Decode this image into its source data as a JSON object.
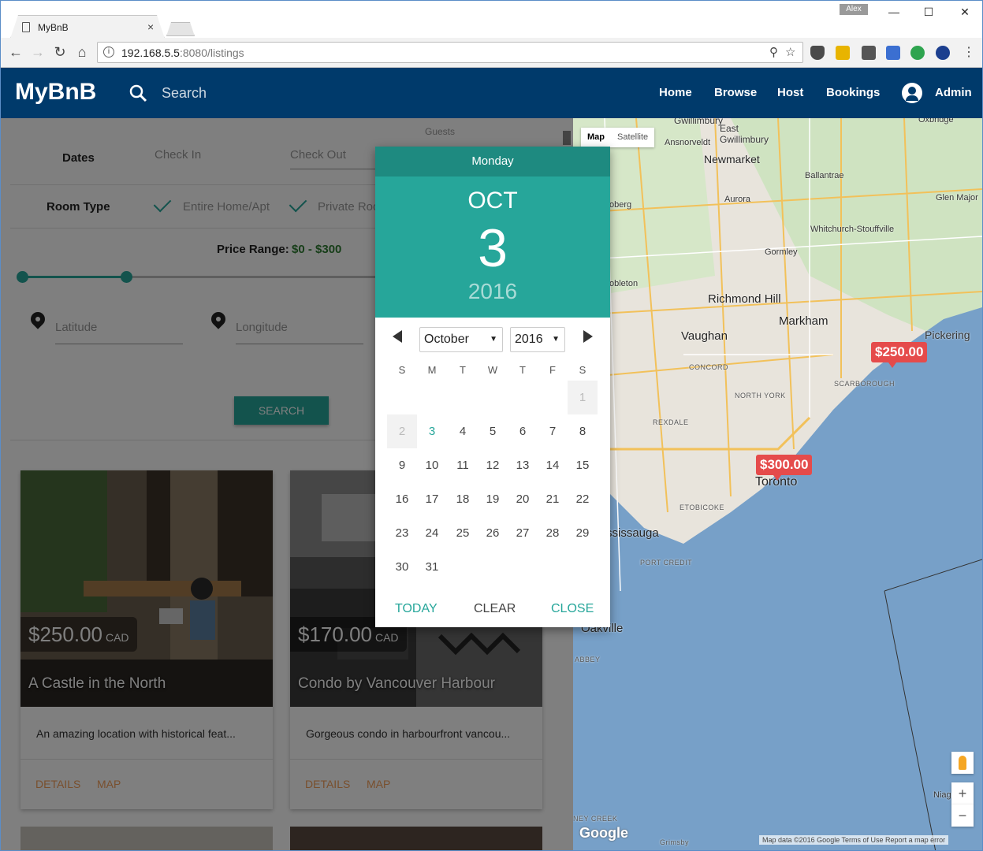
{
  "browser": {
    "tab_title": "MyBnB",
    "tab_close": "×",
    "user_badge": "Alex",
    "minimize": "—",
    "maximize": "☐",
    "close": "✕",
    "url_host": "192.168.5.5",
    "url_rest": ":8080/listings"
  },
  "header": {
    "logo": "MyBnB",
    "search_label": "Search",
    "nav": [
      "Home",
      "Browse",
      "Host",
      "Bookings"
    ],
    "user": "Admin"
  },
  "filters": {
    "guests_label": "Guests",
    "dates_label": "Dates",
    "check_in": "Check In",
    "check_out": "Check Out",
    "room_type_label": "Room Type",
    "room_types": [
      "Entire Home/Apt",
      "Private Roo"
    ],
    "price_label": "Price Range:",
    "price_value": "$0 - $300",
    "price_min_fraction": 0,
    "price_max_fraction": 0.29,
    "latitude": "Latitude",
    "longitude": "Longitude",
    "search_button": "SEARCH"
  },
  "listings": [
    {
      "price": "$250.00",
      "currency": "CAD",
      "title": "A Castle in the North",
      "description": "An amazing location with historical feat...",
      "actions": [
        "DETAILS",
        "MAP"
      ]
    },
    {
      "price": "$170.00",
      "currency": "CAD",
      "title": "Condo by Vancouver Harbour",
      "description": "Gorgeous condo in harbourfront vancou...",
      "actions": [
        "DETAILS",
        "MAP"
      ]
    }
  ],
  "datepicker": {
    "weekday": "Monday",
    "month_short": "OCT",
    "day": "3",
    "year": "2016",
    "month_select": "October",
    "year_select": "2016",
    "weekday_headers": [
      "S",
      "M",
      "T",
      "W",
      "T",
      "F",
      "S"
    ],
    "days": [
      "1",
      "2",
      "3",
      "4",
      "5",
      "6",
      "7",
      "8",
      "9",
      "10",
      "11",
      "12",
      "13",
      "14",
      "15",
      "16",
      "17",
      "18",
      "19",
      "20",
      "21",
      "22",
      "23",
      "24",
      "25",
      "26",
      "27",
      "28",
      "29",
      "30",
      "31"
    ],
    "today_button": "TODAY",
    "clear_button": "CLEAR",
    "close_button": "CLOSE"
  },
  "map": {
    "type_map": "Map",
    "type_satellite": "Satellite",
    "places": [
      "Gwillimbury",
      "East Gwillimbury",
      "Ansnorveldt",
      "Oxbridge",
      "Newmarket",
      "Ballantrae",
      "Aurora",
      "Glen Major",
      "Whitchurch-Stouffville",
      "Gormley",
      "Richmond Hill",
      "Markham",
      "Vaughan",
      "Pickering",
      "Toronto",
      "Oakville",
      "ssissauga",
      "Niagara-o",
      "oberg",
      "obleton"
    ],
    "districts": [
      "CONCORD",
      "NORTH YORK",
      "SCARBOROUGH",
      "REXDALE",
      "ETOBICOKE",
      "PORT CREDIT",
      "ABBEY",
      "NEY CREEK",
      "Grimsby"
    ],
    "price_pins": [
      "$250.00",
      "$300.00"
    ],
    "zoom_in": "+",
    "zoom_out": "−",
    "google": "Google",
    "attribution": "Map data ©2016 Google   Terms of Use   Report a map error"
  }
}
